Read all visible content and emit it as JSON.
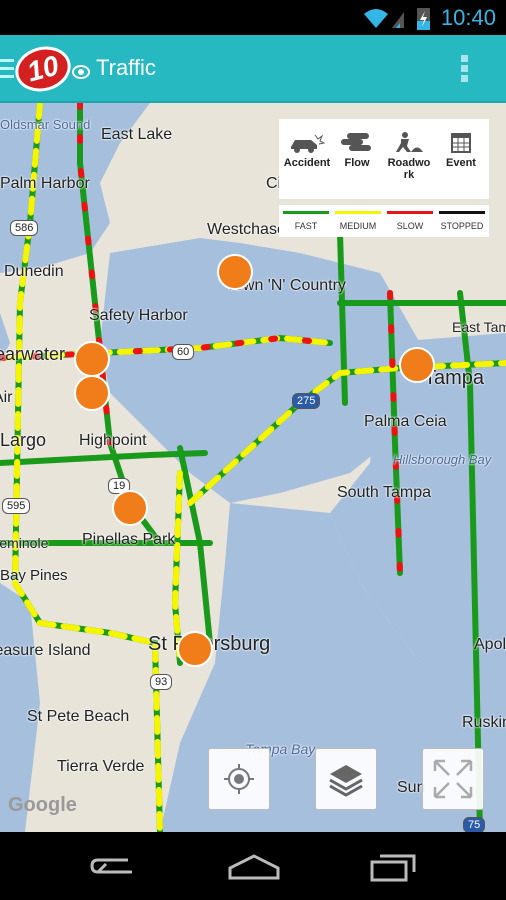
{
  "status_bar": {
    "time": "10:40",
    "icons": [
      "wifi-icon",
      "signal-icon",
      "battery-charging-icon"
    ]
  },
  "app_bar": {
    "logo": "10",
    "title": "Traffic",
    "icons": [
      "menu-icon",
      "cbs-eye-icon",
      "overflow-menu-icon"
    ]
  },
  "legend": {
    "items": [
      {
        "label": "Accident",
        "icon": "accident-icon"
      },
      {
        "label": "Flow",
        "icon": "flow-icon"
      },
      {
        "label": "Roadwork",
        "icon": "roadwork-icon"
      },
      {
        "label": "Event",
        "icon": "event-icon"
      }
    ]
  },
  "speed_legend": [
    {
      "label": "FAST",
      "color": "#1a9a1a"
    },
    {
      "label": "MEDIUM",
      "color": "#f5f500"
    },
    {
      "label": "SLOW",
      "color": "#ee1111"
    },
    {
      "label": "STOPPED",
      "color": "#111111"
    }
  ],
  "map": {
    "labels": [
      "Oldsmar Sound",
      "East Lake",
      "Palm Harbor",
      "Westchase",
      "Dunedin",
      "Town 'N' Country",
      "Safety Harbor",
      "Clearwater",
      "Tampa",
      "East Tampa",
      "Palma Ceia",
      "Clearwater Air",
      "Largo",
      "Highpoint",
      "Hillsborough Bay",
      "South Tampa",
      "Pinellas Park",
      "Seminole",
      "Bay Pines",
      "St Petersburg",
      "Treasure Island",
      "St Pete Beach",
      "Tierra Verde",
      "Tampa Bay",
      "Apollo",
      "Ruskin",
      "Sun",
      "Ci"
    ],
    "shields": [
      "586",
      "60",
      "275",
      "19",
      "595",
      "93",
      "75"
    ],
    "attribution": "Google"
  },
  "controls": [
    "my-location-button",
    "layers-button",
    "fullscreen-button"
  ]
}
